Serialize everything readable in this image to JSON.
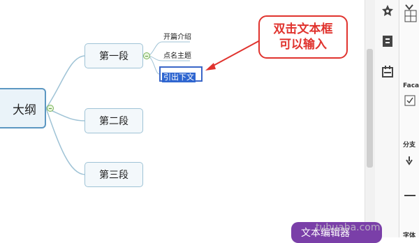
{
  "mindmap": {
    "central_topic": "大纲",
    "topics": [
      {
        "label": "第一段",
        "subtopics": [
          "开篇介绍",
          "点名主题",
          "引出下文"
        ]
      },
      {
        "label": "第二段"
      },
      {
        "label": "第三段"
      }
    ],
    "editing_text": "引出下文"
  },
  "callout": {
    "line1": "双击文本框",
    "line2": "可以输入"
  },
  "right_panel": {
    "facade_label": "Faca",
    "branch_label": "分支",
    "font_label": "字体",
    "rail_icons": [
      "star-icon",
      "outline-icon",
      "tasks-icon"
    ]
  },
  "editor_badge": "文本编辑器",
  "watermark": "tuhuaba.com",
  "colors": {
    "accent": "#e0332e",
    "topic_border": "#9fc3d6",
    "selection": "#2f66d0"
  }
}
